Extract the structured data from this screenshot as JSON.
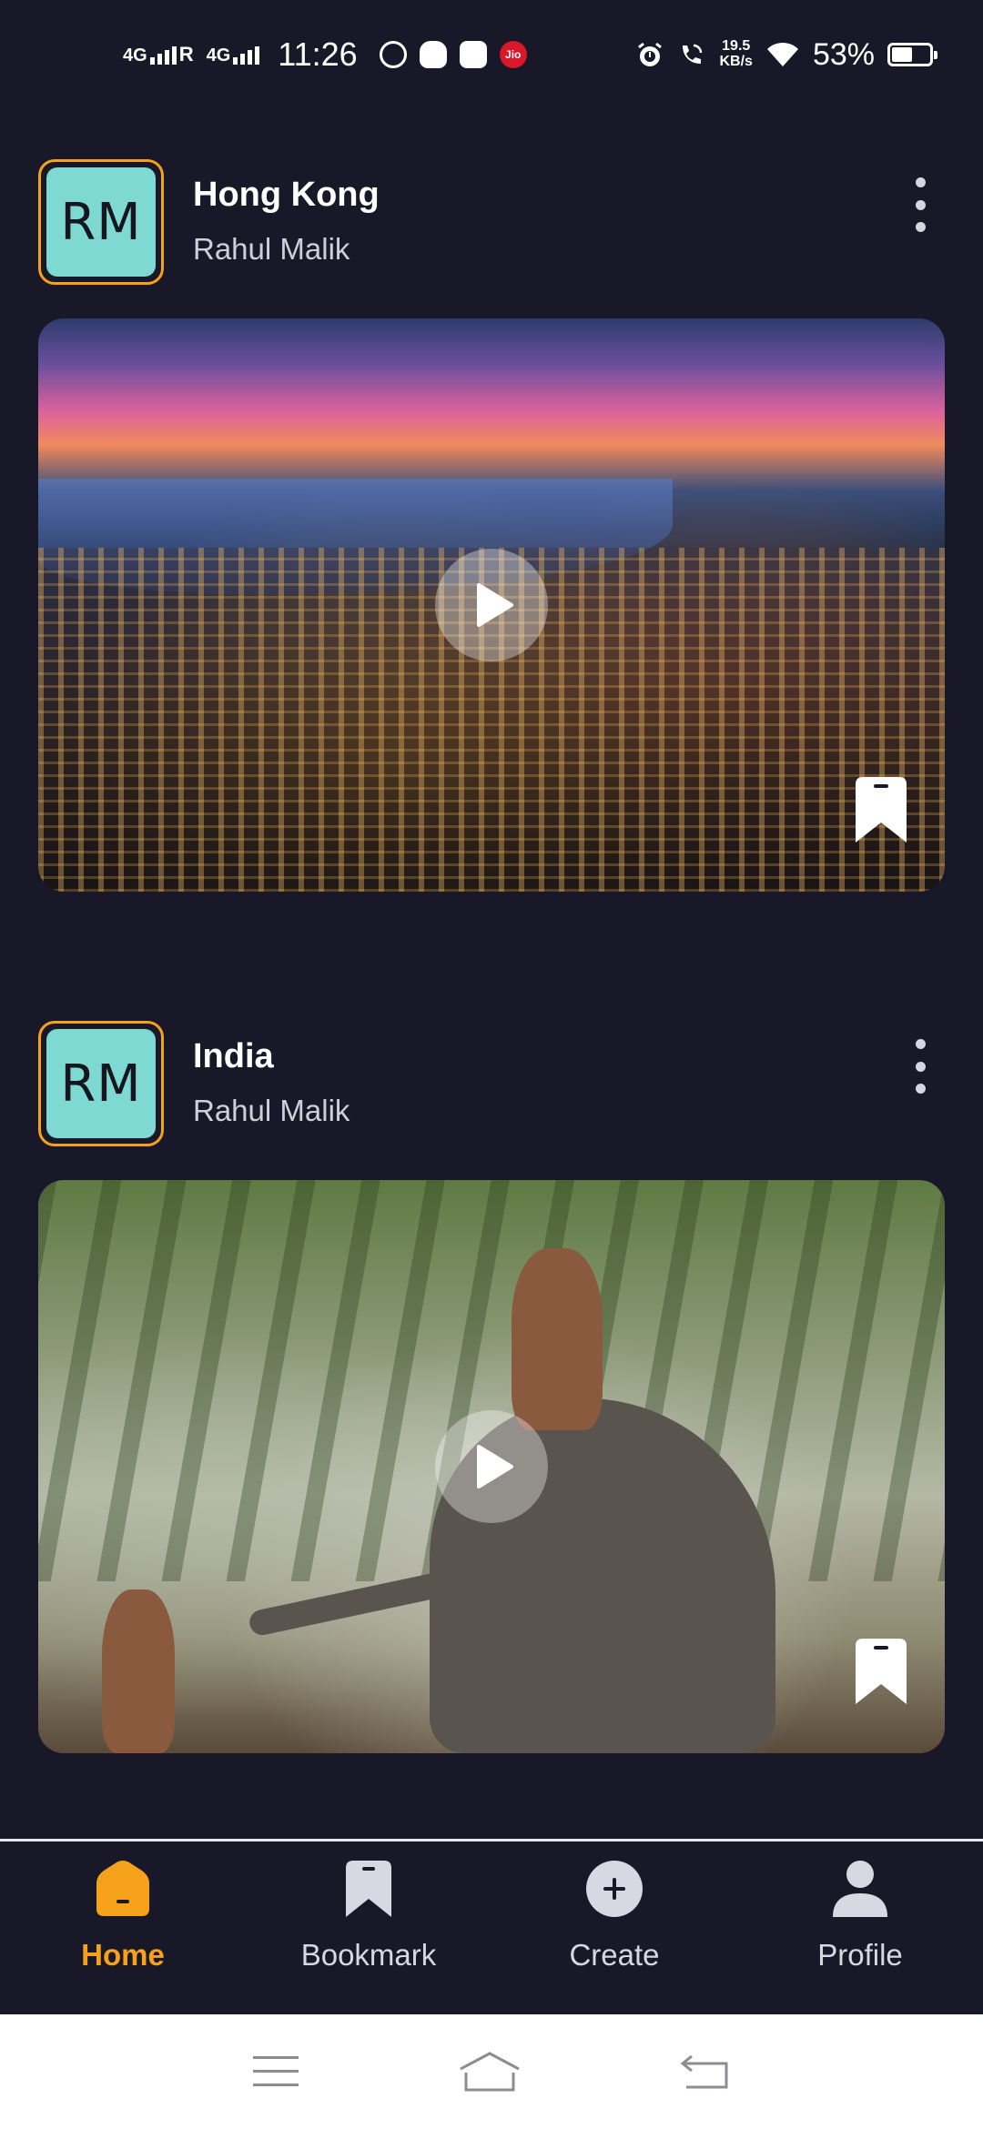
{
  "status_bar": {
    "net1": "4G",
    "roaming": "R",
    "net2": "4G",
    "time": "11:26",
    "jio_label": "Jio",
    "speed_value": "19.5",
    "speed_unit": "KB/s",
    "battery": "53%",
    "battery_level": 0.53
  },
  "posts": [
    {
      "avatar_initials": "RM",
      "title": "Hong Kong",
      "author": "Rahul Malik"
    },
    {
      "avatar_initials": "RM",
      "title": "India",
      "author": "Rahul Malik"
    }
  ],
  "bottom_nav": {
    "items": [
      {
        "label": "Home",
        "icon": "home-icon",
        "active": true
      },
      {
        "label": "Bookmark",
        "icon": "bookmark-icon",
        "active": false
      },
      {
        "label": "Create",
        "icon": "plus-circle-icon",
        "active": false
      },
      {
        "label": "Profile",
        "icon": "person-icon",
        "active": false
      }
    ]
  },
  "colors": {
    "background": "#181828",
    "accent": "#f6a11a",
    "avatar_bg": "#7ed9d3"
  }
}
